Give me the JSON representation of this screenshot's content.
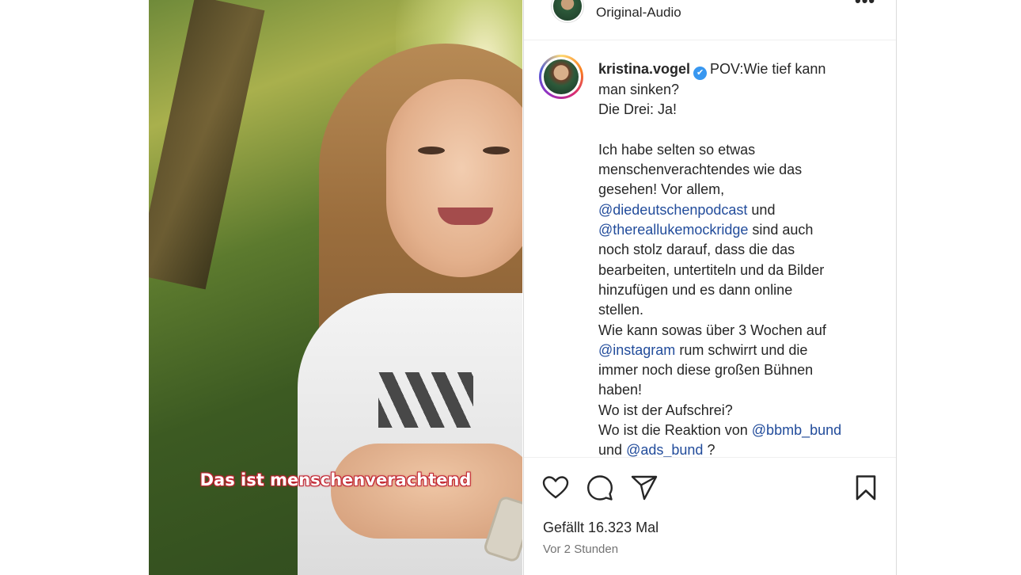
{
  "video": {
    "subtitle": "Das ist menschenverachtend"
  },
  "header": {
    "audio_label": "Original-Audio",
    "more_label": "•••"
  },
  "post": {
    "username": "kristina.vogel",
    "verified_icon": "✔",
    "caption_lines": [
      "POV:Wie tief kann",
      "man sinken?",
      "Die Drei: Ja!",
      "Ich habe selten so etwas",
      "menschenverachtendes wie das",
      "gesehen! Vor allem,",
      "und",
      "sind auch",
      "noch stolz darauf, dass die das",
      "bearbeiten, untertiteln und da Bilder",
      "hinzufügen und es dann online",
      "stellen.",
      "Wie kann sowas über 3 Wochen auf",
      "rum schwirrt und die",
      "immer noch diese großen Bühnen",
      "haben!",
      "Wo ist der Aufschrei?",
      "Wo ist die Reaktion von",
      "und",
      "?"
    ],
    "mentions": {
      "m1": "@diedeutschenpodcast",
      "m2": "@thereallukemockridge",
      "m3": "@instagram",
      "m4": "@bbmb_bund",
      "m5": "@ads_bund"
    }
  },
  "actions": {
    "icons": [
      "heart-icon",
      "comment-icon",
      "share-icon",
      "bookmark-icon"
    ]
  },
  "likes_text": "Gefällt 16.323 Mal",
  "time_text": "Vor 2 Stunden",
  "colors": {
    "mention": "#224c9b",
    "subtitle_outline": "#c0222f",
    "verified": "#3897f0"
  }
}
